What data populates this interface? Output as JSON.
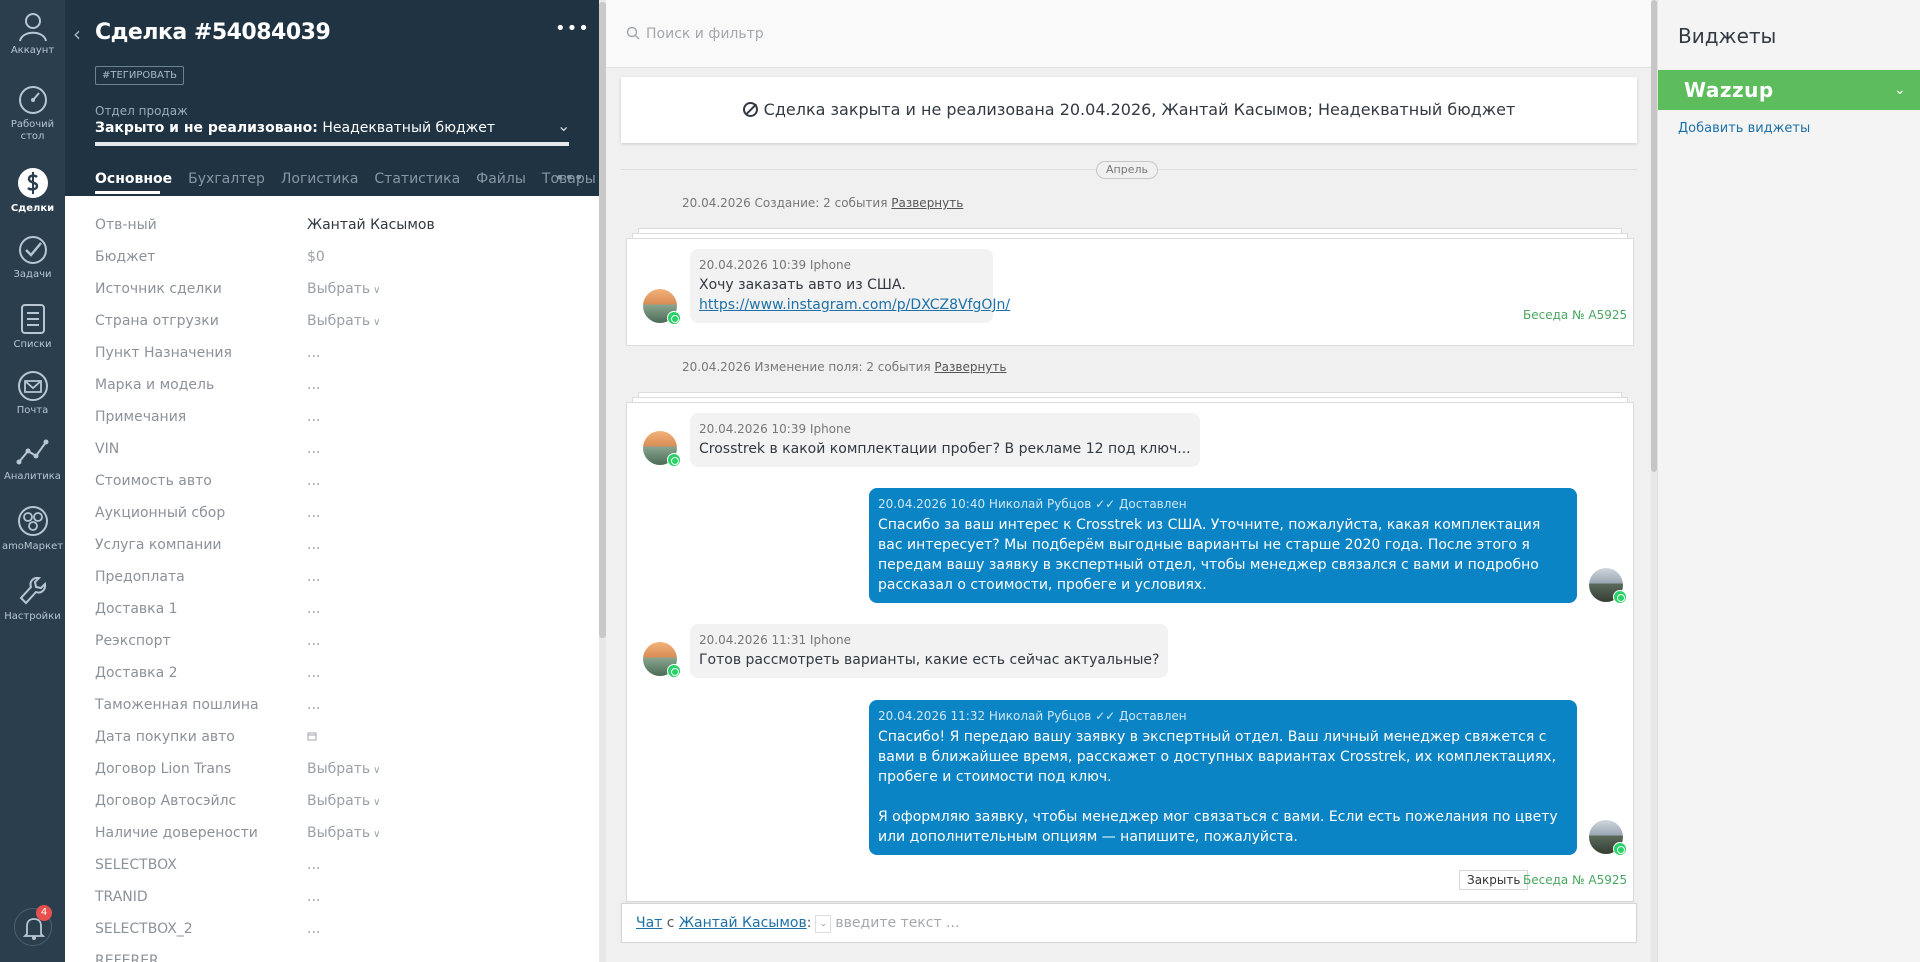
{
  "nav": {
    "items": [
      {
        "key": "account",
        "label": "Аккаунт",
        "icon": "user-icon"
      },
      {
        "key": "dashboard",
        "label": "Рабочий стол",
        "icon": "speedometer-icon"
      },
      {
        "key": "leads",
        "label": "Сделки",
        "icon": "dollar-icon"
      },
      {
        "key": "tasks",
        "label": "Задачи",
        "icon": "check-circle-icon"
      },
      {
        "key": "lists",
        "label": "Списки",
        "icon": "list-icon"
      },
      {
        "key": "mail",
        "label": "Почта",
        "icon": "mail-icon"
      },
      {
        "key": "analytics",
        "label": "Аналитика",
        "icon": "chart-icon"
      },
      {
        "key": "market",
        "label": "amoМаркет",
        "icon": "market-icon"
      },
      {
        "key": "settings",
        "label": "Настройки",
        "icon": "wrench-icon"
      }
    ],
    "notifications_count": "4"
  },
  "lead": {
    "title": "Сделка #54084039",
    "tag_button": "#ТЕГИРОВАТЬ",
    "pipeline_label": "Отдел продаж",
    "status_strong": "Закрыто и не реализовано:",
    "status_reason": "Неадекватный бюджет",
    "tabs": [
      "Основное",
      "Бухгалтер",
      "Логистика",
      "Статистика",
      "Файлы",
      "Товары"
    ],
    "fields": [
      {
        "label": "Отв-ный",
        "value": "Жантай Касымов",
        "kind": "strong"
      },
      {
        "label": "Бюджет",
        "value": "$0",
        "kind": "budget"
      },
      {
        "label": "Источник сделки",
        "value": "Выбрать",
        "kind": "select"
      },
      {
        "label": "Страна отгрузки",
        "value": "Выбрать",
        "kind": "select"
      },
      {
        "label": "Пункт Назначения",
        "value": "...",
        "kind": "text"
      },
      {
        "label": "Марка и модель",
        "value": "...",
        "kind": "text"
      },
      {
        "label": "Примечания",
        "value": "...",
        "kind": "text"
      },
      {
        "label": "VIN",
        "value": "...",
        "kind": "text"
      },
      {
        "label": "Стоимость авто",
        "value": "...",
        "kind": "text"
      },
      {
        "label": "Аукционный сбор",
        "value": "...",
        "kind": "text"
      },
      {
        "label": "Услуга компании",
        "value": "...",
        "kind": "text"
      },
      {
        "label": "Предоплата",
        "value": "...",
        "kind": "text"
      },
      {
        "label": "Доставка 1",
        "value": "...",
        "kind": "text"
      },
      {
        "label": "Реэкспорт",
        "value": "...",
        "kind": "text"
      },
      {
        "label": "Доставка 2",
        "value": "...",
        "kind": "text"
      },
      {
        "label": "Таможенная пошлина",
        "value": "...",
        "kind": "text"
      },
      {
        "label": "Дата покупки авто",
        "value": "",
        "kind": "date"
      },
      {
        "label": "Договор Lion Trans",
        "value": "Выбрать",
        "kind": "select"
      },
      {
        "label": "Договор Автосэйлс",
        "value": "Выбрать",
        "kind": "select"
      },
      {
        "label": "Наличие довереноcти",
        "value": "Выбрать",
        "kind": "select"
      },
      {
        "label": "SELECTBOX",
        "value": "...",
        "kind": "text"
      },
      {
        "label": "TRANID",
        "value": "...",
        "kind": "text"
      },
      {
        "label": "SELECTBOX_2",
        "value": "...",
        "kind": "text"
      },
      {
        "label": "REFERER",
        "value": "",
        "kind": "text"
      }
    ]
  },
  "feed": {
    "search_placeholder": "Поиск и фильтр",
    "closed_banner": "Сделка закрыта и не реализована 20.04.2026, Жантай Касымов; Неадекватный бюджет",
    "month_pill": "Апрель",
    "group1": {
      "text": "20.04.2026 Создание: 2 события",
      "link": "Развернуть"
    },
    "group2": {
      "text": "20.04.2026 Изменение поля: 2 события",
      "link": "Развернуть"
    },
    "conv1": {
      "msg_meta": "20.04.2026 10:39 Iphone",
      "msg_text": "Хочу заказать авто из США.",
      "msg_link": "https://www.instagram.com/p/DXCZ8VfgOJn/",
      "conv_number": "Беседа № A5925"
    },
    "conv2": {
      "m1_meta": "20.04.2026 10:39 Iphone",
      "m1_text": "Crosstrek в какой комплектации пробег? В рекламе 12 под ключ...",
      "m2_meta": "20.04.2026 10:40 Николай Рубцов ✓✓ Доставлен",
      "m2_text": "Спасибо за ваш интерес к Crosstrek из США. Уточните, пожалуйста, какая комплектация вас интересует? Мы подберём выгодные варианты не старше 2020 года. После этого я передам вашу заявку в экспертный отдел, чтобы менеджер связался с вами и подробно рассказал о стоимости, пробеге и условиях.",
      "m3_meta": "20.04.2026 11:31 Iphone",
      "m3_text": "Готов рассмотреть варианты, какие есть сейчас актуальные?",
      "m4_meta": "20.04.2026 11:32 Николай Рубцов ✓✓ Доставлен",
      "m4_text": "Спасибо! Я передаю вашу заявку в экспертный отдел. Ваш личный менеджер свяжется с вами в ближайшее время, расскажет о доступных вариантах Crosstrek, их комплектациях, пробеге и стоимости под ключ.\n\nЯ оформляю заявку, чтобы менеджер мог связаться с вами. Если есть пожелания по цвету или дополнительным опциям — напишите, пожалуйста.",
      "close_button": "Закрыть",
      "conv_number": "Беседа № A5925"
    },
    "composer": {
      "chat_link": "Чат",
      "with_text": "с",
      "contact_link": "Жантай Касымов",
      "colon": ":",
      "input_placeholder": "введите текст ..."
    }
  },
  "widgets": {
    "title": "Виджеты",
    "wazzup_label": "Wazzup",
    "add_link": "Добавить виджеты"
  },
  "colors": {
    "nav_bg": "#2a3e4e",
    "card_header_bg": "#1f3342",
    "outgoing_bubble": "#0a84c5",
    "wazzup_green": "#5dbd5d",
    "link_blue": "#1d71a8",
    "conv_number_green": "#4aa660"
  }
}
